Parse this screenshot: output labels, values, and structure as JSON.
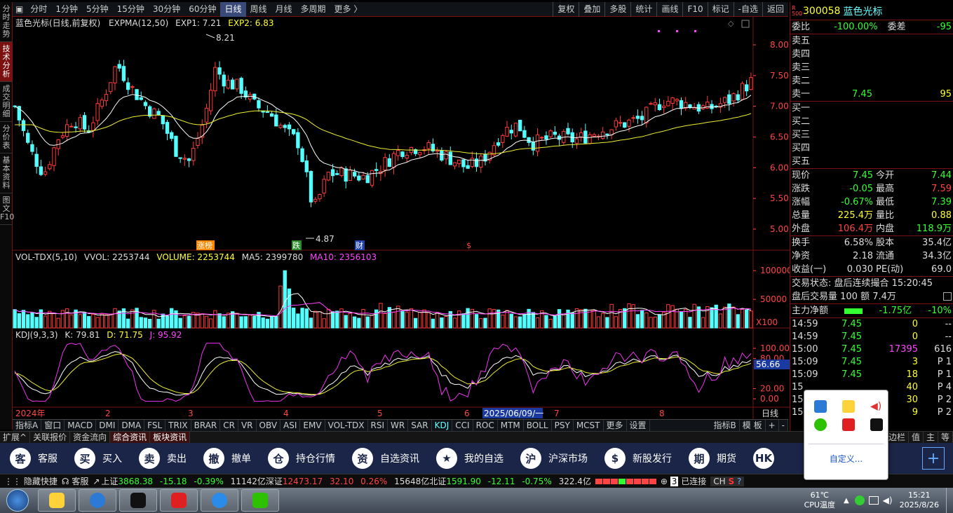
{
  "toolbar": {
    "periods": [
      "分时",
      "1分钟",
      "5分钟",
      "15分钟",
      "30分钟",
      "60分钟",
      "日线",
      "周线",
      "月线",
      "多周期",
      "更多 〉"
    ],
    "selected": "日线",
    "right_tools": [
      "复权",
      "叠加",
      "多股",
      "统计",
      "画线",
      "F10",
      "标记",
      "-自选",
      "返回"
    ]
  },
  "left_tabs": [
    "分时走势",
    "技术分析",
    "成交明细",
    "分价表",
    "基本资料",
    "图文F10"
  ],
  "left_tab_selected": "技术分析",
  "main_chart": {
    "title": "蓝色光标(日线,前复权)",
    "indicator": "EXPMA(12,50)",
    "exp1_label": "EXP1: 7.21",
    "exp2_label": "EXP2: 6.83",
    "high_marker": "8.21",
    "low_marker": "4.87",
    "event_tags": [
      "涨榜",
      "跌",
      "财",
      "$"
    ],
    "y_ticks": [
      "8.00",
      "7.50",
      "7.00",
      "6.50",
      "6.00",
      "5.50",
      "5.00"
    ]
  },
  "volume_chart": {
    "indicator": "VOL-TDX(5,10)",
    "vvol": "VVOL: 2253744",
    "volume": "VOLUME: 2253744",
    "ma5": "MA5: 2399780",
    "ma10": "MA10: 2356103",
    "y_ticks": [
      "100000",
      "50000"
    ],
    "unit": "X100"
  },
  "kdj_chart": {
    "indicator": "KDJ(9,3,3)",
    "k": "K: 79.81",
    "d": "D: 71.75",
    "j": "J: 95.92",
    "y_ticks": [
      "100.00",
      "80.00",
      "20.00",
      "0.00"
    ],
    "current": "56.66"
  },
  "x_axis": {
    "labels": [
      "2024年",
      "2",
      "3",
      "4",
      "5",
      "6",
      "2025/06/09/一",
      "7",
      "8"
    ],
    "period_tag": "日线"
  },
  "indicator_tabs": [
    "指标A",
    "窗口",
    "MACD",
    "DMI",
    "DMA",
    "FSL",
    "TRIX",
    "BRAR",
    "CR",
    "VR",
    "OBV",
    "ASI",
    "EMV",
    "VOL-TDX",
    "RSI",
    "WR",
    "SAR",
    "KDJ",
    "CCI",
    "ROC",
    "MTM",
    "BOLL",
    "PSY",
    "MCST",
    "更多",
    "设置"
  ],
  "indicator_selected": "KDJ",
  "indicator_right": [
    "指标B",
    "模 板",
    "+",
    "-"
  ],
  "sub_tabs": [
    "扩展^",
    "关联报价",
    "资金流向",
    "综合资讯",
    "板块资讯"
  ],
  "sub_selected": [
    "综合资讯",
    "板块资讯"
  ],
  "sub_right": [
    "侧边栏",
    "值",
    "主",
    "等"
  ],
  "quote": {
    "code_badge": "R 500",
    "code": "300058",
    "name": "蓝色光标",
    "weibi_label": "委比",
    "weibi": "-100.00%",
    "weicha_label": "委差",
    "weicha": "-95",
    "sell": [
      {
        "label": "卖五",
        "price": "",
        "vol": ""
      },
      {
        "label": "卖四",
        "price": "",
        "vol": ""
      },
      {
        "label": "卖三",
        "price": "",
        "vol": ""
      },
      {
        "label": "卖二",
        "price": "",
        "vol": ""
      },
      {
        "label": "卖一",
        "price": "7.45",
        "vol": "95"
      }
    ],
    "buy": [
      {
        "label": "买一"
      },
      {
        "label": "买二"
      },
      {
        "label": "买三"
      },
      {
        "label": "买四"
      },
      {
        "label": "买五"
      }
    ],
    "stats": [
      {
        "l1": "现价",
        "v1": "7.45",
        "l2": "今开",
        "v2": "7.44",
        "c1": "g",
        "c2": "g"
      },
      {
        "l1": "涨跌",
        "v1": "-0.05",
        "l2": "最高",
        "v2": "7.59",
        "c1": "g",
        "c2": "r"
      },
      {
        "l1": "涨幅",
        "v1": "-0.67%",
        "l2": "最低",
        "v2": "7.39",
        "c1": "g",
        "c2": "g"
      },
      {
        "l1": "总量",
        "v1": "225.4万",
        "l2": "量比",
        "v2": "0.88",
        "c1": "y",
        "c2": "y"
      },
      {
        "l1": "外盘",
        "v1": "106.4万",
        "l2": "内盘",
        "v2": "118.9万",
        "c1": "r",
        "c2": "g"
      }
    ],
    "stats2": [
      {
        "l1": "换手",
        "v1": "6.58%",
        "l2": "股本",
        "v2": "35.4亿"
      },
      {
        "l1": "净资",
        "v1": "2.18",
        "l2": "流通",
        "v2": "34.3亿"
      },
      {
        "l1": "收益(一)",
        "v1": "0.030",
        "l2": "PE(动)",
        "v2": "69.0"
      }
    ],
    "trade_status": "交易状态: 盘后连续撮合 15:20:45",
    "after_hours": "盘后交易量 100 额 7.4万",
    "main_flow_label": "主力净额",
    "main_flow": "-1.75亿",
    "main_flow_pct": "-10%",
    "ticks": [
      {
        "t": "14:59",
        "p": "7.45",
        "v": "0",
        "x": "--"
      },
      {
        "t": "14:59",
        "p": "7.45",
        "v": "0",
        "x": "--"
      },
      {
        "t": "15:00",
        "p": "7.45",
        "v": "17395",
        "x": "616"
      },
      {
        "t": "15:09",
        "p": "7.45",
        "v": "3",
        "x": "P 1"
      },
      {
        "t": "15:09",
        "p": "7.45",
        "v": "18",
        "x": "P 1"
      },
      {
        "t": "15",
        "p": "",
        "v": "40",
        "x": "P 4"
      },
      {
        "t": "15",
        "p": "",
        "v": "30",
        "x": "P 2"
      },
      {
        "t": "15",
        "p": "",
        "v": "9",
        "x": "P 2"
      }
    ]
  },
  "main_buttons": [
    {
      "icon": "客",
      "label": "客服"
    },
    {
      "icon": "买",
      "label": "买入"
    },
    {
      "icon": "卖",
      "label": "卖出"
    },
    {
      "icon": "撤",
      "label": "撤单"
    },
    {
      "icon": "仓",
      "label": "持仓行情"
    },
    {
      "icon": "资",
      "label": "自选资讯"
    },
    {
      "icon": "★",
      "label": "我的自选"
    },
    {
      "icon": "沪",
      "label": "沪深市场"
    },
    {
      "icon": "$",
      "label": "新股发行"
    },
    {
      "icon": "期",
      "label": "期货"
    },
    {
      "icon": "HK",
      "label": ""
    }
  ],
  "statusbar": {
    "hide": "隐藏快捷",
    "service": "客服",
    "sh_label": "上证",
    "sh_val": "3868.38",
    "sh_chg": "-15.18",
    "sh_pct": "-0.39%",
    "sh_amt": "11142亿",
    "sz_label": "深证",
    "sz_val": "12473.17",
    "sz_chg": "32.10",
    "sz_pct": "0.26%",
    "sz_amt": "15648亿",
    "bz_label": "北证",
    "bz_val": "1591.90",
    "bz_chg": "-12.11",
    "bz_pct": "-0.75%",
    "bz_amt": "322.4亿",
    "conn_count": "3",
    "connected": "已连接",
    "ime": "CH"
  },
  "popup": {
    "custom": "自定义..."
  },
  "taskbar": {
    "temp": "61℃",
    "temp_label": "CPU温度",
    "time": "15:21",
    "date": "2025/8/26"
  }
}
